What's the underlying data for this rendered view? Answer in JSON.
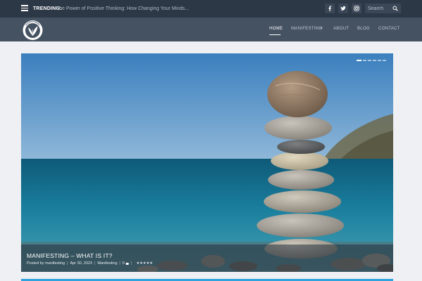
{
  "topbar": {
    "trending_label": "TRENDING:",
    "trending_text": "The Power of Positive Thinking: How Changing Your Minds...",
    "search_placeholder": "Search",
    "social_icons": [
      "facebook-icon",
      "twitter-icon",
      "instagram-icon"
    ]
  },
  "nav": {
    "items": [
      {
        "label": "HOME",
        "active": true
      },
      {
        "label": "MANIFESTING",
        "has_dropdown": true
      },
      {
        "label": "ABOUT"
      },
      {
        "label": "BLOG"
      },
      {
        "label": "CONTACT"
      }
    ]
  },
  "slider": {
    "slide_count": 6,
    "active_index": 0,
    "title": "MANIFESTING – WHAT IS IT?",
    "meta": {
      "author_prefix": "Posted by",
      "author": "manifesting",
      "date": "Apr 30, 2023",
      "category": "Manifesting",
      "comments": "0",
      "rating_stars": "★★★★★"
    }
  },
  "colors": {
    "topbar_bg": "#2c3846",
    "header_bg": "#455262",
    "page_bg": "#eef0f3",
    "accent": "#2ea3dd"
  }
}
